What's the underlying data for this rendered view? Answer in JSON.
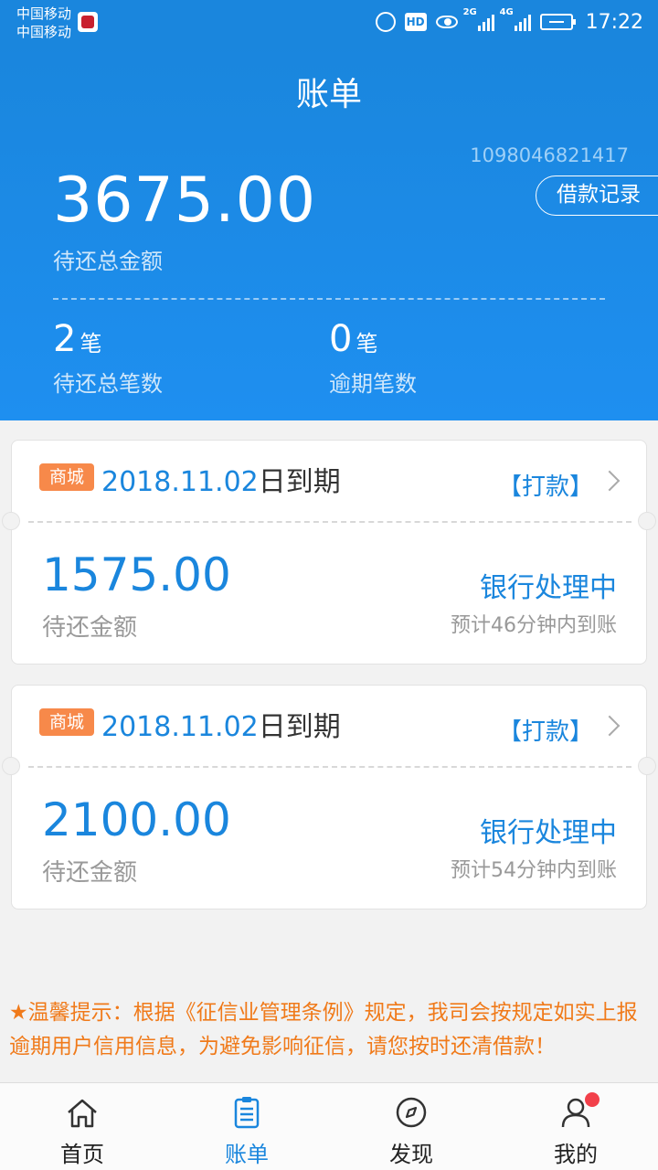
{
  "status_bar": {
    "carrier_1": "中国移动",
    "carrier_2": "中国移动",
    "hd_label": "HD",
    "network_1": "2G",
    "network_2": "4G",
    "time": "17:22"
  },
  "header": {
    "title": "账单",
    "account_number": "1098046821417",
    "loan_record_button": "借款记录",
    "total_amount": "3675.00",
    "total_label": "待还总金额",
    "stats": [
      {
        "count": "2",
        "unit": "笔",
        "label": "待还总笔数"
      },
      {
        "count": "0",
        "unit": "笔",
        "label": "逾期笔数"
      }
    ]
  },
  "bills": [
    {
      "tag": "商城",
      "date": "2018.11.02",
      "date_suffix": "日到期",
      "action": "【打款】",
      "amount": "1575.00",
      "amount_label": "待还金额",
      "status": "银行处理中",
      "eta": "预计46分钟内到账"
    },
    {
      "tag": "商城",
      "date": "2018.11.02",
      "date_suffix": "日到期",
      "action": "【打款】",
      "amount": "2100.00",
      "amount_label": "待还金额",
      "status": "银行处理中",
      "eta": "预计54分钟内到账"
    }
  ],
  "notice": "★温馨提示：根据《征信业管理条例》规定，我司会按规定如实上报逾期用户信用信息，为避免影响征信，请您按时还清借款！",
  "tabbar": {
    "tabs": [
      {
        "label": "首页",
        "icon": "home-icon",
        "active": false
      },
      {
        "label": "账单",
        "icon": "bill-icon",
        "active": true
      },
      {
        "label": "发现",
        "icon": "compass-icon",
        "active": false
      },
      {
        "label": "我的",
        "icon": "profile-icon",
        "active": false,
        "badge": true
      }
    ]
  },
  "colors": {
    "primary": "#1a86dd",
    "tag_orange": "#f7894a",
    "notice_orange": "#f07a1a",
    "badge_red": "#f2404a"
  }
}
